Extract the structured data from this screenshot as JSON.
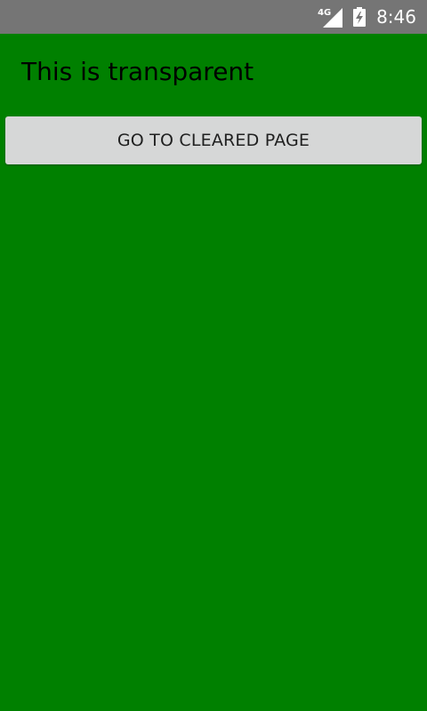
{
  "status_bar": {
    "network_type": "4G",
    "signal_icon": "cellular-signal-icon",
    "battery_icon": "battery-charging-icon",
    "time": "8:46"
  },
  "page": {
    "heading": "This is transparent",
    "button_label": "GO TO CLEARED PAGE",
    "background_color": "#008000"
  }
}
